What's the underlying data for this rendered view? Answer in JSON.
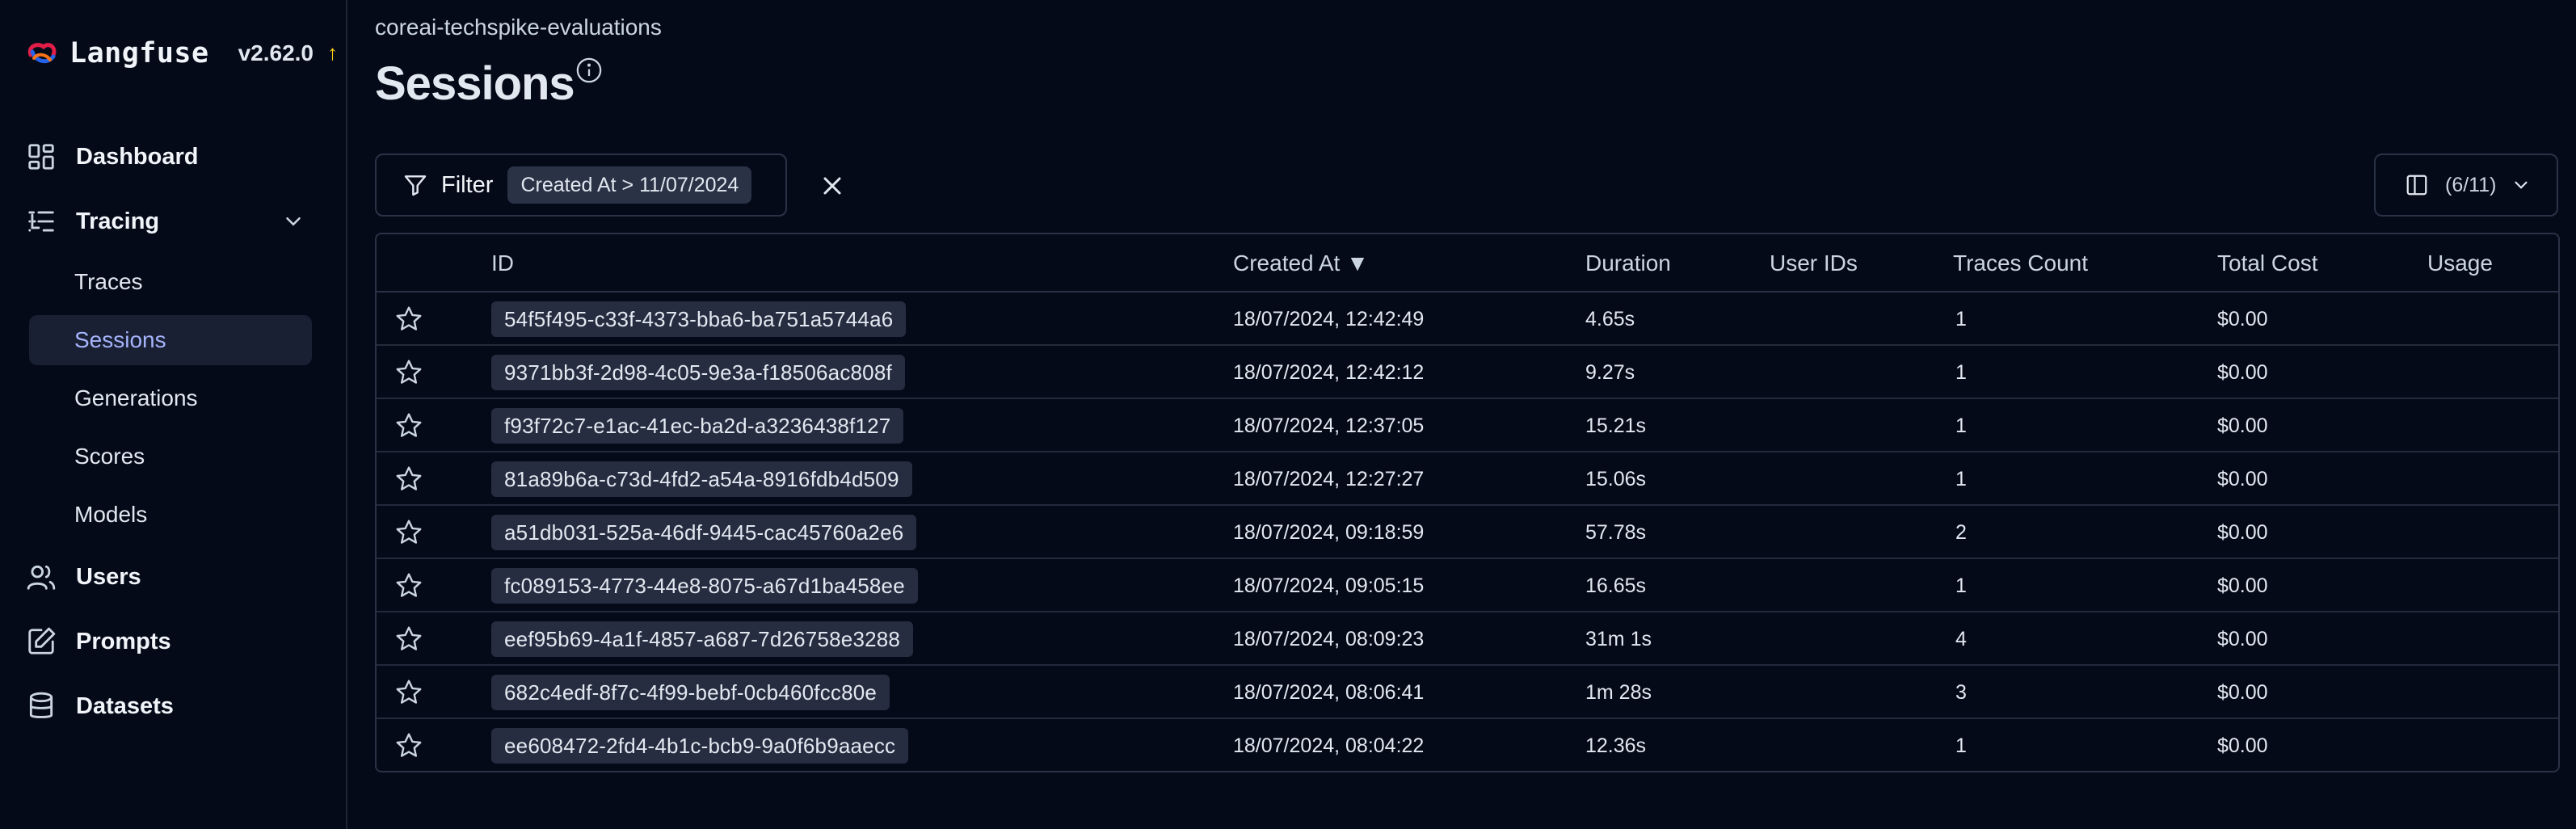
{
  "brand": {
    "name": "Langfuse",
    "version": "v2.62.0",
    "update_indicator": "↑"
  },
  "sidebar": {
    "items": [
      {
        "label": "Dashboard",
        "icon": "dashboard-icon"
      },
      {
        "label": "Tracing",
        "icon": "tracing-icon",
        "expanded": true
      },
      {
        "label": "Users",
        "icon": "users-icon"
      },
      {
        "label": "Prompts",
        "icon": "prompts-icon"
      },
      {
        "label": "Datasets",
        "icon": "datasets-icon"
      }
    ],
    "tracing_sub": [
      {
        "label": "Traces"
      },
      {
        "label": "Sessions",
        "active": true
      },
      {
        "label": "Generations"
      },
      {
        "label": "Scores"
      },
      {
        "label": "Models"
      }
    ]
  },
  "header": {
    "project": "coreai-techspike-evaluations",
    "title": "Sessions"
  },
  "toolbar": {
    "filter_label": "Filter",
    "filter_chip": "Created At > 11/07/2024",
    "columns_count": "(6/11)"
  },
  "table": {
    "headers": {
      "id": "ID",
      "created_at": "Created At ▼",
      "duration": "Duration",
      "user_ids": "User IDs",
      "traces_count": "Traces Count",
      "total_cost": "Total Cost",
      "usage": "Usage"
    },
    "rows": [
      {
        "id": "54f5f495-c33f-4373-bba6-ba751a5744a6",
        "created_at": "18/07/2024, 12:42:49",
        "duration": "4.65s",
        "user_ids": "",
        "traces_count": "1",
        "total_cost": "$0.00",
        "usage": ""
      },
      {
        "id": "9371bb3f-2d98-4c05-9e3a-f18506ac808f",
        "created_at": "18/07/2024, 12:42:12",
        "duration": "9.27s",
        "user_ids": "",
        "traces_count": "1",
        "total_cost": "$0.00",
        "usage": ""
      },
      {
        "id": "f93f72c7-e1ac-41ec-ba2d-a3236438f127",
        "created_at": "18/07/2024, 12:37:05",
        "duration": "15.21s",
        "user_ids": "",
        "traces_count": "1",
        "total_cost": "$0.00",
        "usage": ""
      },
      {
        "id": "81a89b6a-c73d-4fd2-a54a-8916fdb4d509",
        "created_at": "18/07/2024, 12:27:27",
        "duration": "15.06s",
        "user_ids": "",
        "traces_count": "1",
        "total_cost": "$0.00",
        "usage": ""
      },
      {
        "id": "a51db031-525a-46df-9445-cac45760a2e6",
        "created_at": "18/07/2024, 09:18:59",
        "duration": "57.78s",
        "user_ids": "",
        "traces_count": "2",
        "total_cost": "$0.00",
        "usage": ""
      },
      {
        "id": "fc089153-4773-44e8-8075-a67d1ba458ee",
        "created_at": "18/07/2024, 09:05:15",
        "duration": "16.65s",
        "user_ids": "",
        "traces_count": "1",
        "total_cost": "$0.00",
        "usage": ""
      },
      {
        "id": "eef95b69-4a1f-4857-a687-7d26758e3288",
        "created_at": "18/07/2024, 08:09:23",
        "duration": "31m 1s",
        "user_ids": "",
        "traces_count": "4",
        "total_cost": "$0.00",
        "usage": ""
      },
      {
        "id": "682c4edf-8f7c-4f99-bebf-0cb460fcc80e",
        "created_at": "18/07/2024, 08:06:41",
        "duration": "1m 28s",
        "user_ids": "",
        "traces_count": "3",
        "total_cost": "$0.00",
        "usage": ""
      },
      {
        "id": "ee608472-2fd4-4b1c-bcb9-9a0f6b9aaecc",
        "created_at": "18/07/2024, 08:04:22",
        "duration": "12.36s",
        "user_ids": "",
        "traces_count": "1",
        "total_cost": "$0.00",
        "usage": ""
      }
    ]
  }
}
